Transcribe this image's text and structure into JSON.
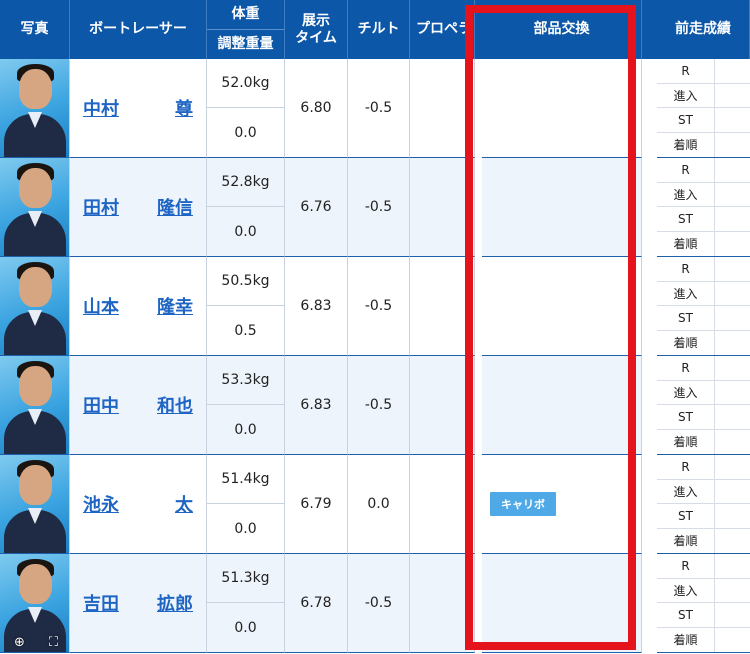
{
  "headers": {
    "photo": "写真",
    "racer": "ボートレーサー",
    "weight": "体重",
    "adjust": "調整重量",
    "exhibit_time": "展示\nタイム",
    "tilt": "チルト",
    "propeller": "プロペラ",
    "parts": "部品交換",
    "previous": "前走成績"
  },
  "previous_labels": [
    "R",
    "進入",
    "ST",
    "着順"
  ],
  "racers": [
    {
      "name_family": "中村",
      "name_given": "尊",
      "weight": "52.0kg",
      "adjust": "0.0",
      "exhibit": "6.80",
      "tilt": "-0.5",
      "parts": ""
    },
    {
      "name_family": "田村",
      "name_given": "隆信",
      "weight": "52.8kg",
      "adjust": "0.0",
      "exhibit": "6.76",
      "tilt": "-0.5",
      "parts": ""
    },
    {
      "name_family": "山本",
      "name_given": "隆幸",
      "weight": "50.5kg",
      "adjust": "0.5",
      "exhibit": "6.83",
      "tilt": "-0.5",
      "parts": ""
    },
    {
      "name_family": "田中",
      "name_given": "和也",
      "weight": "53.3kg",
      "adjust": "0.0",
      "exhibit": "6.83",
      "tilt": "-0.5",
      "parts": ""
    },
    {
      "name_family": "池永",
      "name_given": "太",
      "weight": "51.4kg",
      "adjust": "0.0",
      "exhibit": "6.79",
      "tilt": "0.0",
      "parts": "キャリボ"
    },
    {
      "name_family": "吉田",
      "name_given": "拡郎",
      "weight": "51.3kg",
      "adjust": "0.0",
      "exhibit": "6.78",
      "tilt": "-0.5",
      "parts": ""
    }
  ],
  "colors": {
    "header_bg": "#0c57a8",
    "link": "#1f65c4",
    "highlight_frame": "#e5131b",
    "badge": "#4fa9e6"
  },
  "zoom_icons": [
    "zoom-in-icon",
    "fullscreen-icon"
  ]
}
